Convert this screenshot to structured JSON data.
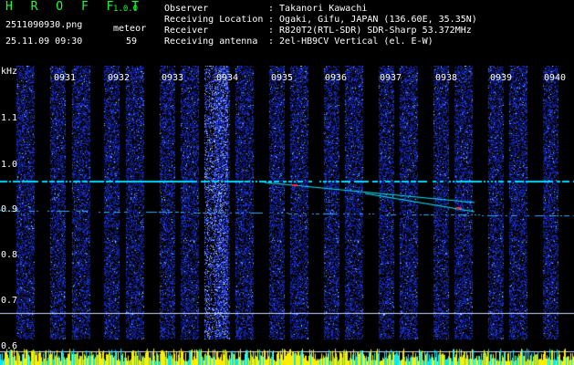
{
  "header": {
    "app_title": "H R O F F T",
    "version": "1.0.0",
    "file_name": "2511090930.png",
    "datetime": "25.11.09 09:30",
    "meteor_label": "meteor",
    "meteor_count": "59",
    "info": [
      {
        "key": "Observer",
        "value": ": Takanori Kawachi"
      },
      {
        "key": "Receiving Location",
        "value": ": Ogaki, Gifu, JAPAN (136.60E, 35.35N)"
      },
      {
        "key": "Receiver",
        "value": ": R820T2(RTL-SDR) SDR-Sharp 53.372MHz"
      },
      {
        "key": "Receiving antenna",
        "value": ": 2el-HB9CV Vertical (el. E-W)"
      }
    ]
  },
  "spectrogram": {
    "unit_label": "kHz",
    "time_labels": [
      "0931",
      "0932",
      "0933",
      "0934",
      "0935",
      "0936",
      "0937",
      "0938",
      "0939",
      "0940"
    ],
    "freq_labels": [
      "1.1",
      "1.0",
      "0.9",
      "0.8",
      "0.7",
      "0.6"
    ],
    "colors": {
      "background": "#000000",
      "noise": "#1a2bd8",
      "signal": "#00e8ff",
      "activity": "#ffee00"
    }
  }
}
